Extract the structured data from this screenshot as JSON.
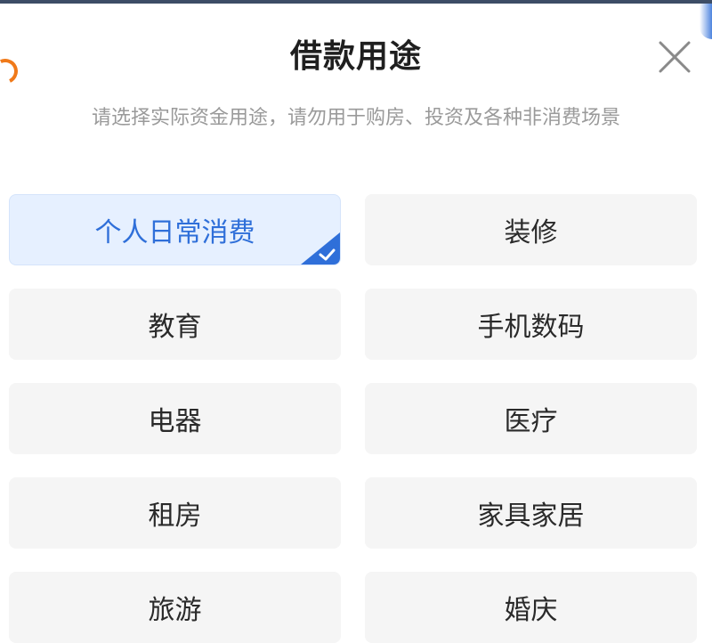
{
  "dialog": {
    "title": "借款用途",
    "subtitle": "请选择实际资金用途，请勿用于购房、投资及各种非消费场景"
  },
  "options": [
    {
      "label": "个人日常消费",
      "selected": true
    },
    {
      "label": "装修",
      "selected": false
    },
    {
      "label": "教育",
      "selected": false
    },
    {
      "label": "手机数码",
      "selected": false
    },
    {
      "label": "电器",
      "selected": false
    },
    {
      "label": "医疗",
      "selected": false
    },
    {
      "label": "租房",
      "selected": false
    },
    {
      "label": "家具家居",
      "selected": false
    },
    {
      "label": "旅游",
      "selected": false
    },
    {
      "label": "婚庆",
      "selected": false
    }
  ],
  "icons": {
    "close": "close-icon",
    "check": "checkmark-icon"
  },
  "colors": {
    "accent": "#2f6fd9",
    "selected_bg": "#e6f0ff",
    "option_bg": "#f5f5f5",
    "subtitle": "#9a9a9a",
    "title": "#1f1f1f"
  }
}
